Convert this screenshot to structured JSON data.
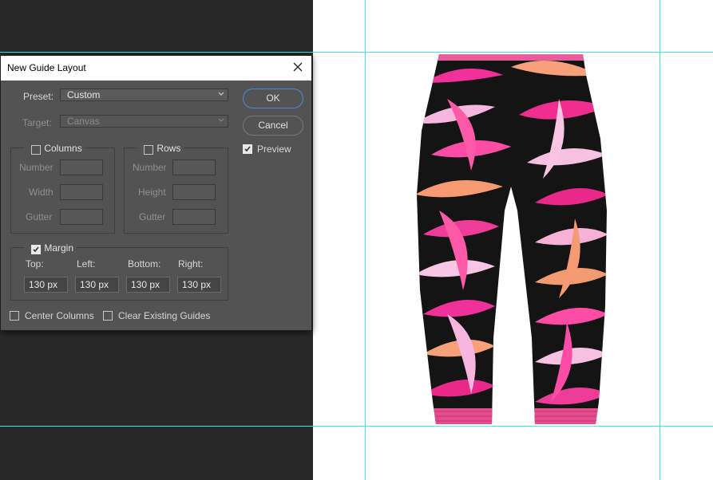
{
  "dialog": {
    "title": "New Guide Layout",
    "preset_label": "Preset:",
    "preset_value": "Custom",
    "target_label": "Target:",
    "target_value": "Canvas",
    "ok_label": "OK",
    "cancel_label": "Cancel",
    "preview_label": "Preview",
    "preview_checked": true,
    "columns": {
      "label": "Columns",
      "checked": false,
      "number_label": "Number",
      "width_label": "Width",
      "gutter_label": "Gutter"
    },
    "rows": {
      "label": "Rows",
      "checked": false,
      "number_label": "Number",
      "height_label": "Height",
      "gutter_label": "Gutter"
    },
    "margin": {
      "label": "Margin",
      "checked": true,
      "top_label": "Top:",
      "left_label": "Left:",
      "bottom_label": "Bottom:",
      "right_label": "Right:",
      "top_value": "130 px",
      "left_value": "130 px",
      "bottom_value": "130 px",
      "right_value": "130 px"
    },
    "center_columns_label": "Center Columns",
    "center_columns_checked": false,
    "clear_guides_label": "Clear Existing Guides",
    "clear_guides_checked": false
  },
  "icons": {
    "close": "close-icon",
    "dropdown": "chevron-down-icon",
    "check": "checkmark-icon"
  },
  "colors": {
    "guide": "#3ee6ee",
    "dialog_bg": "#535353",
    "primary_button_border": "#4f86e0",
    "workspace_bg": "#282828"
  }
}
